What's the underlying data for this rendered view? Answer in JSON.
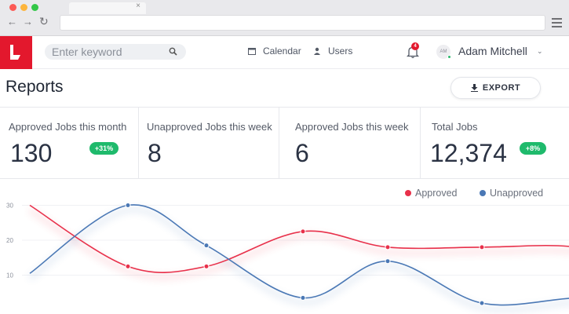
{
  "browser": {
    "tab_close": "×"
  },
  "header": {
    "search_placeholder": "Enter keyword",
    "nav": [
      {
        "label": "Calendar",
        "icon": "calendar-icon"
      },
      {
        "label": "Users",
        "icon": "user-icon"
      }
    ],
    "notifications_count": "4",
    "avatar_initials": "AM",
    "user_name": "Adam Mitchell",
    "brand_color": "#e3182d"
  },
  "page": {
    "title": "Reports",
    "export_label": "EXPORT"
  },
  "stats": [
    {
      "label": "Approved Jobs this month",
      "value": "130",
      "badge": "+31%"
    },
    {
      "label": "Unapproved Jobs this week",
      "value": "8",
      "badge": ""
    },
    {
      "label": "Approved Jobs this week",
      "value": "6",
      "badge": ""
    },
    {
      "label": "Total Jobs",
      "value": "12,374",
      "badge": "+8%"
    }
  ],
  "chart_data": {
    "type": "line",
    "title": "",
    "xlabel": "",
    "ylabel": "",
    "y_ticks": [
      "10",
      "20",
      "30"
    ],
    "ylim": [
      0,
      33
    ],
    "x": [
      0,
      1,
      2,
      3,
      4,
      5,
      6,
      7
    ],
    "series": [
      {
        "name": "Approved",
        "color": "#e8304a",
        "values": [
          30,
          12.5,
          12.5,
          22.5,
          18,
          18,
          18,
          11.5
        ]
      },
      {
        "name": "Unapproved",
        "color": "#4a78b5",
        "values": [
          10.5,
          30,
          18.5,
          3.5,
          14,
          2,
          3.5,
          3.5
        ]
      }
    ],
    "legend_position": "top-right",
    "grid": true
  }
}
